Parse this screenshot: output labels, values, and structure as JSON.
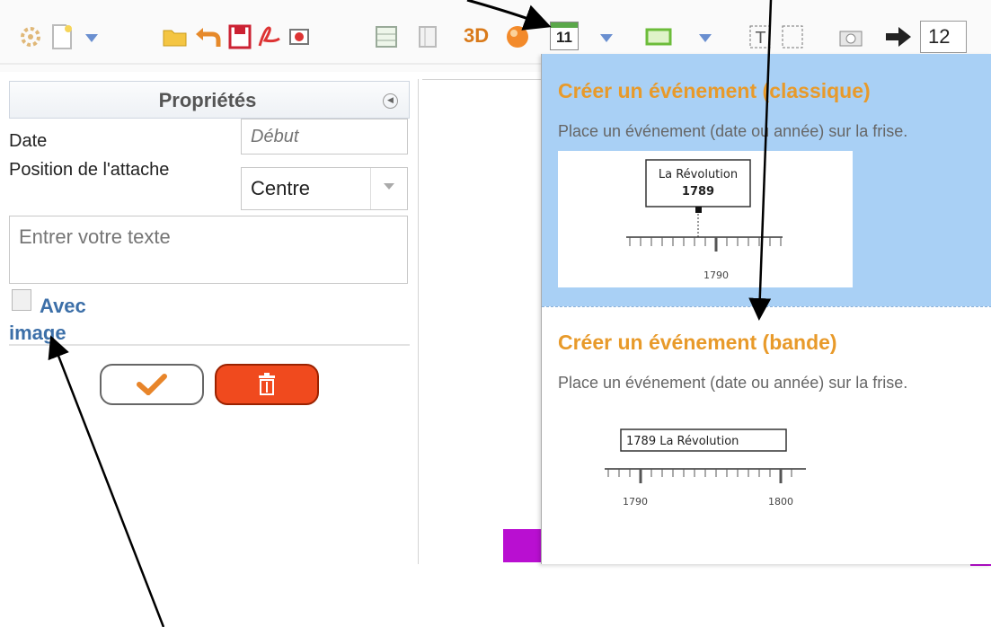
{
  "toolbar": {
    "label_3d": "3D",
    "calendar_day": "11",
    "number_value": "12"
  },
  "panel": {
    "title": "Propriétés",
    "date_label": "Date",
    "date_placeholder": "Début",
    "position_label": "Position de l'attache",
    "position_value": "Centre",
    "text_placeholder": "Entrer votre texte",
    "checkbox_label": "Avec image"
  },
  "menu": {
    "items": [
      {
        "title": "Créer un événement (classique)",
        "description": "Place un événement (date ou année) sur la frise.",
        "preview_box_line1": "La Révolution",
        "preview_box_line2": "1789",
        "preview_tick": "1790"
      },
      {
        "title": "Créer un événement (bande)",
        "description": "Place un événement (date ou année) sur la frise.",
        "preview_box_text": "1789  La Révolution",
        "preview_tick_a": "1790",
        "preview_tick_b": "1800"
      }
    ]
  },
  "colors": {
    "menu_highlight": "#a9d0f5",
    "menu_title": "#e89a2a",
    "delete_button": "#f04a1e",
    "accent_purple": "#b90fd1"
  }
}
